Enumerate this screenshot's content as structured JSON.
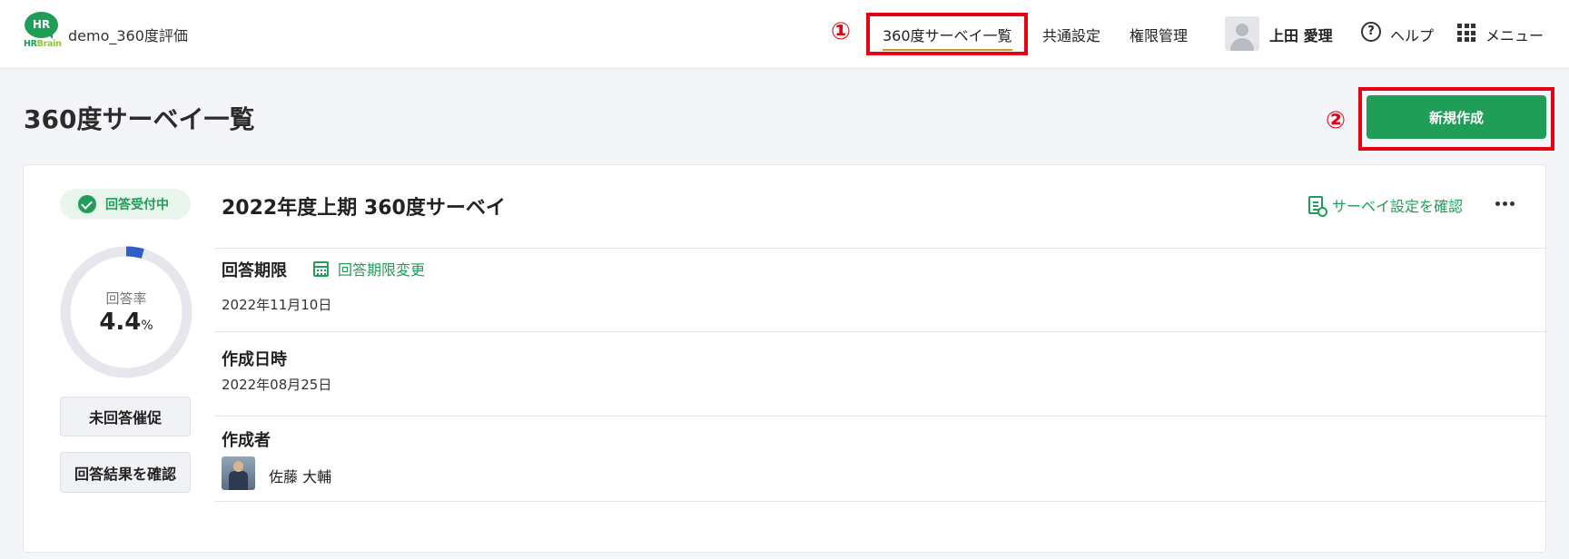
{
  "header": {
    "logo_text": "HR",
    "logo_brand_a": "HR",
    "logo_brand_b": "Brain",
    "app_name": "demo_360度評価",
    "nav": [
      {
        "label": "360度サーベイ一覧",
        "active": true
      },
      {
        "label": "共通設定"
      },
      {
        "label": "権限管理"
      }
    ],
    "user_name": "上田 愛理",
    "help_label": "ヘルプ",
    "menu_label": "メニュー"
  },
  "annotations": {
    "marker_1": "①",
    "marker_2": "②",
    "color": "#e60012"
  },
  "page": {
    "title": "360度サーベイ一覧",
    "new_button_label": "新規作成"
  },
  "survey": {
    "status": "回答受付中",
    "response_rate_label": "回答率",
    "response_rate_value": "4.4",
    "response_rate_unit": "%",
    "response_rate": 4.4,
    "remind_button": "未回答催促",
    "results_button": "回答結果を確認",
    "title": "2022年度上期 360度サーベイ",
    "settings_link": "サーベイ設定を確認",
    "deadline_label": "回答期限",
    "deadline_change_link": "回答期限変更",
    "deadline_value": "2022年11月10日",
    "created_label": "作成日時",
    "created_value": "2022年08月25日",
    "author_label": "作成者",
    "author_name": "佐藤 大輔"
  },
  "colors": {
    "accent": "#1f9e57",
    "progress": "#2f5fc4",
    "track": "#e5e7ec"
  }
}
